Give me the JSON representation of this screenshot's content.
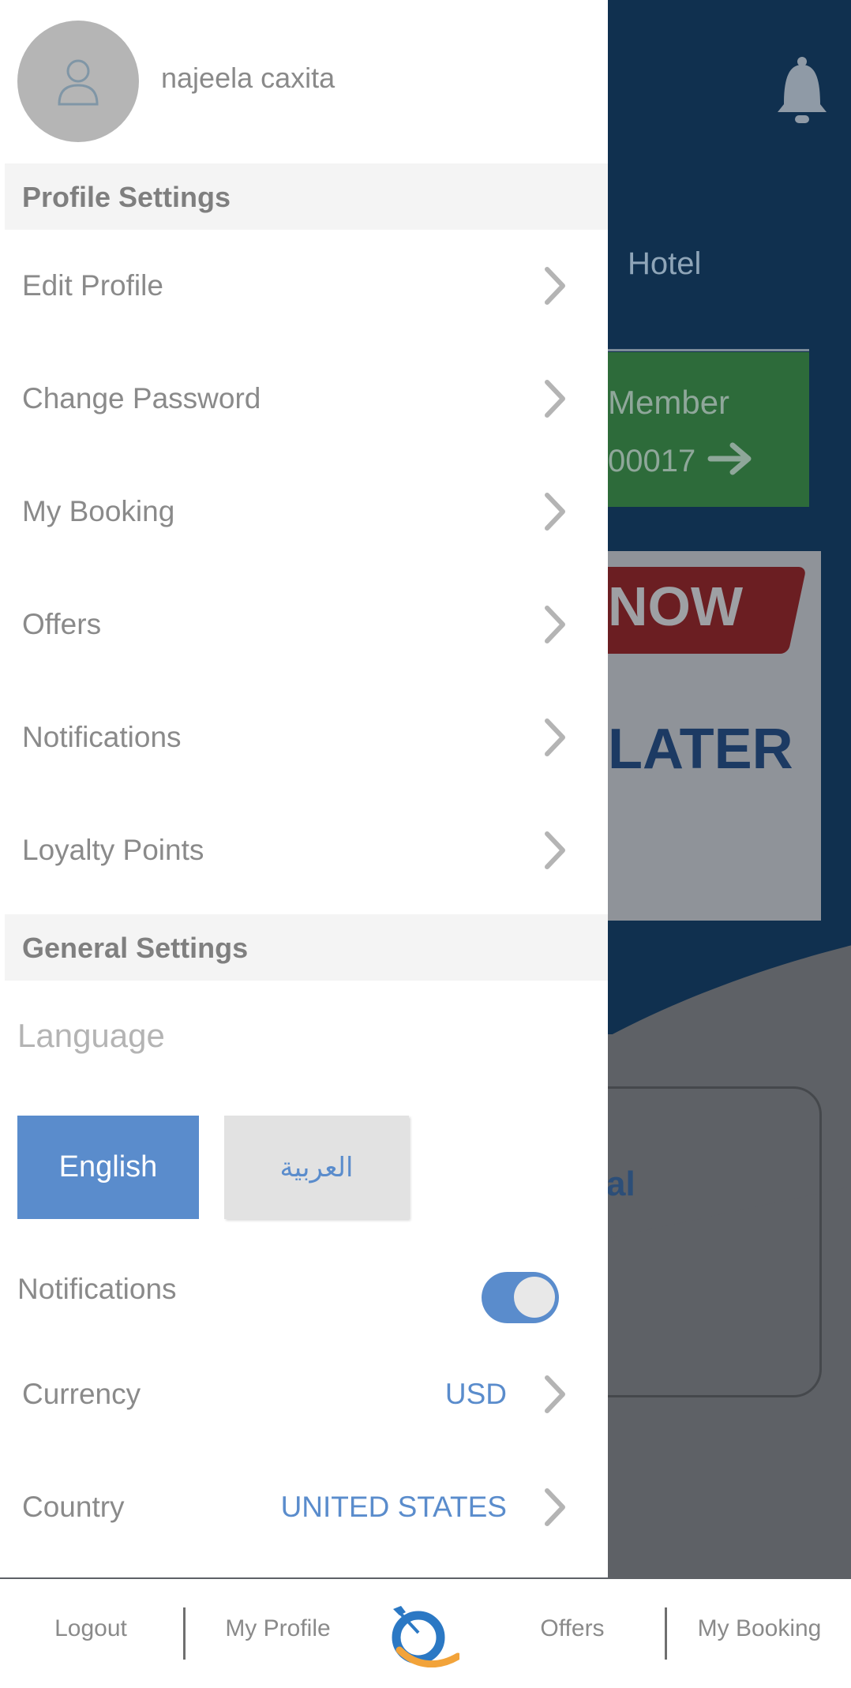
{
  "background": {
    "hotel_tab": "Hotel",
    "member_title": "Member",
    "member_id": "00017",
    "banner_now": "NOW",
    "banner_later": "LATER",
    "card_text": "al"
  },
  "drawer": {
    "user_name": "najeela caxita",
    "profile_settings_title": "Profile Settings",
    "profile_items": [
      {
        "label": "Edit Profile"
      },
      {
        "label": "Change Password"
      },
      {
        "label": "My Booking"
      },
      {
        "label": "Offers"
      },
      {
        "label": "Notifications"
      },
      {
        "label": "Loyalty Points"
      }
    ],
    "general_settings_title": "General Settings",
    "language_label": "Language",
    "language_options": {
      "english": "English",
      "arabic": "العربية"
    },
    "selected_language": "English",
    "notifications_label": "Notifications",
    "notifications_enabled": true,
    "currency": {
      "label": "Currency",
      "value": "USD"
    },
    "country": {
      "label": "Country",
      "value": "UNITED STATES"
    }
  },
  "bottom_nav": {
    "logout": "Logout",
    "my_profile": "My Profile",
    "offers": "Offers",
    "my_booking": "My Booking"
  },
  "colors": {
    "accent": "#5a8ccc",
    "header_dim": "#10304f",
    "member_dim": "#2d6b3a"
  }
}
